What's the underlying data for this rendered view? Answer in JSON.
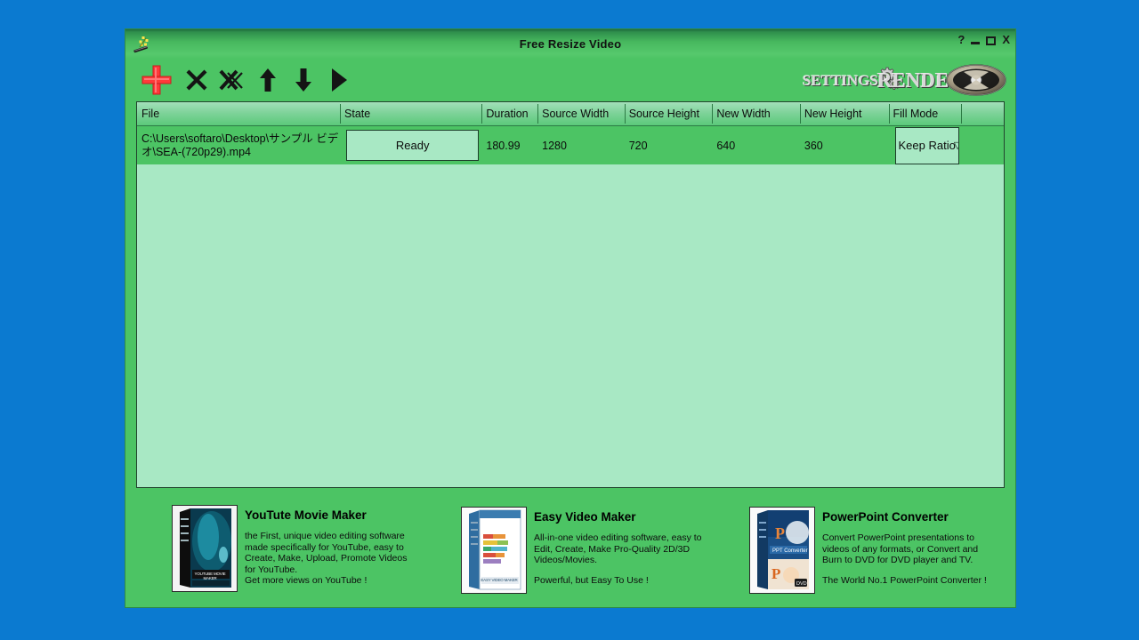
{
  "window": {
    "title": "Free Resize Video",
    "icon_name": "magic-wand-icon",
    "help_label": "?",
    "minimize_label": "",
    "maximize_label": "",
    "close_label": "X"
  },
  "toolbar": {
    "add_label": "+",
    "add_icon": "plus-icon",
    "remove_icon": "x-icon",
    "remove_all_icon": "double-x-icon",
    "move_up_icon": "arrow-up-icon",
    "move_down_icon": "arrow-down-icon",
    "play_icon": "play-triangle-icon",
    "settings_label": "SETTINGS",
    "settings_icon": "gears-icon",
    "render_label": "RENDER",
    "render_icon": "film-reel-icon"
  },
  "table": {
    "columns": [
      "File",
      "State",
      "Duration",
      "Source Width",
      "Source Height",
      "New Width",
      "New Height",
      "Fill Mode",
      ""
    ],
    "rows": [
      {
        "file": "C:\\Users\\softaro\\Desktop\\サンプル ビデオ\\SEA-(720p29).mp4",
        "state": "Ready",
        "duration": "180.99",
        "source_width": "1280",
        "source_height": "720",
        "new_width": "640",
        "new_height": "360",
        "fill_mode": "Keep Ratio",
        "fill_mode_arrow": "▽"
      }
    ]
  },
  "ads": [
    {
      "title": "YouTute Movie Maker",
      "body": "the First, unique video editing software\nmade specifically for YouTube, easy to\nCreate, Make, Upload, Promote Videos\nfor YouTube.\nGet more views on YouTube !",
      "tagline": "",
      "thumb_caption": "YOUTUBE MOVIE MAKER"
    },
    {
      "title": "Easy Video Maker",
      "body": "All-in-one video editing software, easy to\nEdit, Create, Make Pro-Quality 2D/3D\nVideos/Movies.",
      "tagline": "Powerful, but Easy To Use !",
      "thumb_caption": "EASY VIDEO MAKER"
    },
    {
      "title": "PowerPoint Converter",
      "body": "Convert PowerPoint presentations to\nvideos of any formats, or Convert and\nBurn to DVD for DVD player and TV.",
      "tagline": "The World No.1 PowerPoint Converter !",
      "thumb_caption": "PPT Converter"
    }
  ],
  "colors": {
    "desktop_blue": "#0b7ad0",
    "window_green": "#4cc464",
    "list_background": "#a8e8c4",
    "header_green": "#7fd39a",
    "accent_red": "#ff3a3a",
    "text_dark": "#0b0b0b"
  }
}
